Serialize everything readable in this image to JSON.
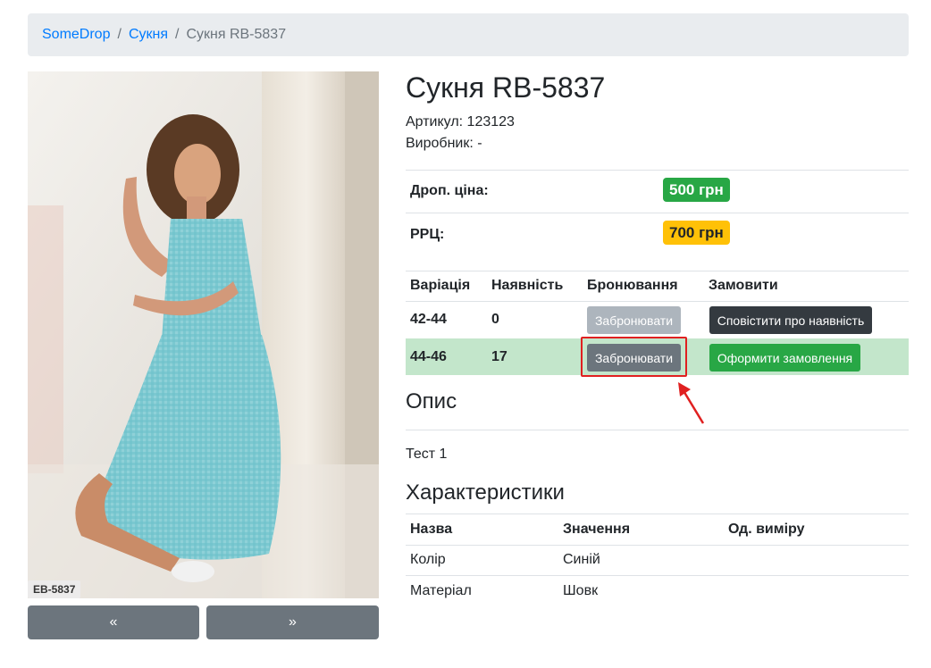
{
  "breadcrumb": {
    "home": "SomeDrop",
    "separator": "/",
    "category": "Сукня",
    "current": "Сукня RB-5837"
  },
  "product": {
    "image_tag": "EB-5837",
    "prev_label": "«",
    "next_label": "»",
    "title": "Сукня RB-5837",
    "article": "Артикул: 123123",
    "manufacturer": "Виробник: -"
  },
  "prices": {
    "drop_label": "Дроп. ціна:",
    "drop_value": "500 грн",
    "rrc_label": "РРЦ:",
    "rrc_value": "700 грн"
  },
  "variations": {
    "headers": [
      "Варіація",
      "Наявність",
      "Бронювання",
      "Замовити"
    ],
    "rows": [
      {
        "size": "42-44",
        "stock": "0",
        "reserve": "Забронювати",
        "order": "Сповістити про наявність"
      },
      {
        "size": "44-46",
        "stock": "17",
        "reserve": "Забронювати",
        "order": "Оформити замовлення"
      }
    ]
  },
  "description": {
    "heading": "Опис",
    "text": "Тест 1"
  },
  "characteristics": {
    "heading": "Характеристики",
    "headers": [
      "Назва",
      "Значення",
      "Од. виміру"
    ],
    "rows": [
      {
        "name": "Колір",
        "value": "Синій",
        "unit": ""
      },
      {
        "name": "Матеріал",
        "value": "Шовк",
        "unit": ""
      }
    ]
  },
  "colors": {
    "link": "#007bff",
    "success": "#28a745",
    "warning": "#ffc107",
    "secondary": "#6c757d",
    "dark": "#343a40",
    "row_highlight": "#c3e6cb",
    "callout": "#e02020"
  }
}
